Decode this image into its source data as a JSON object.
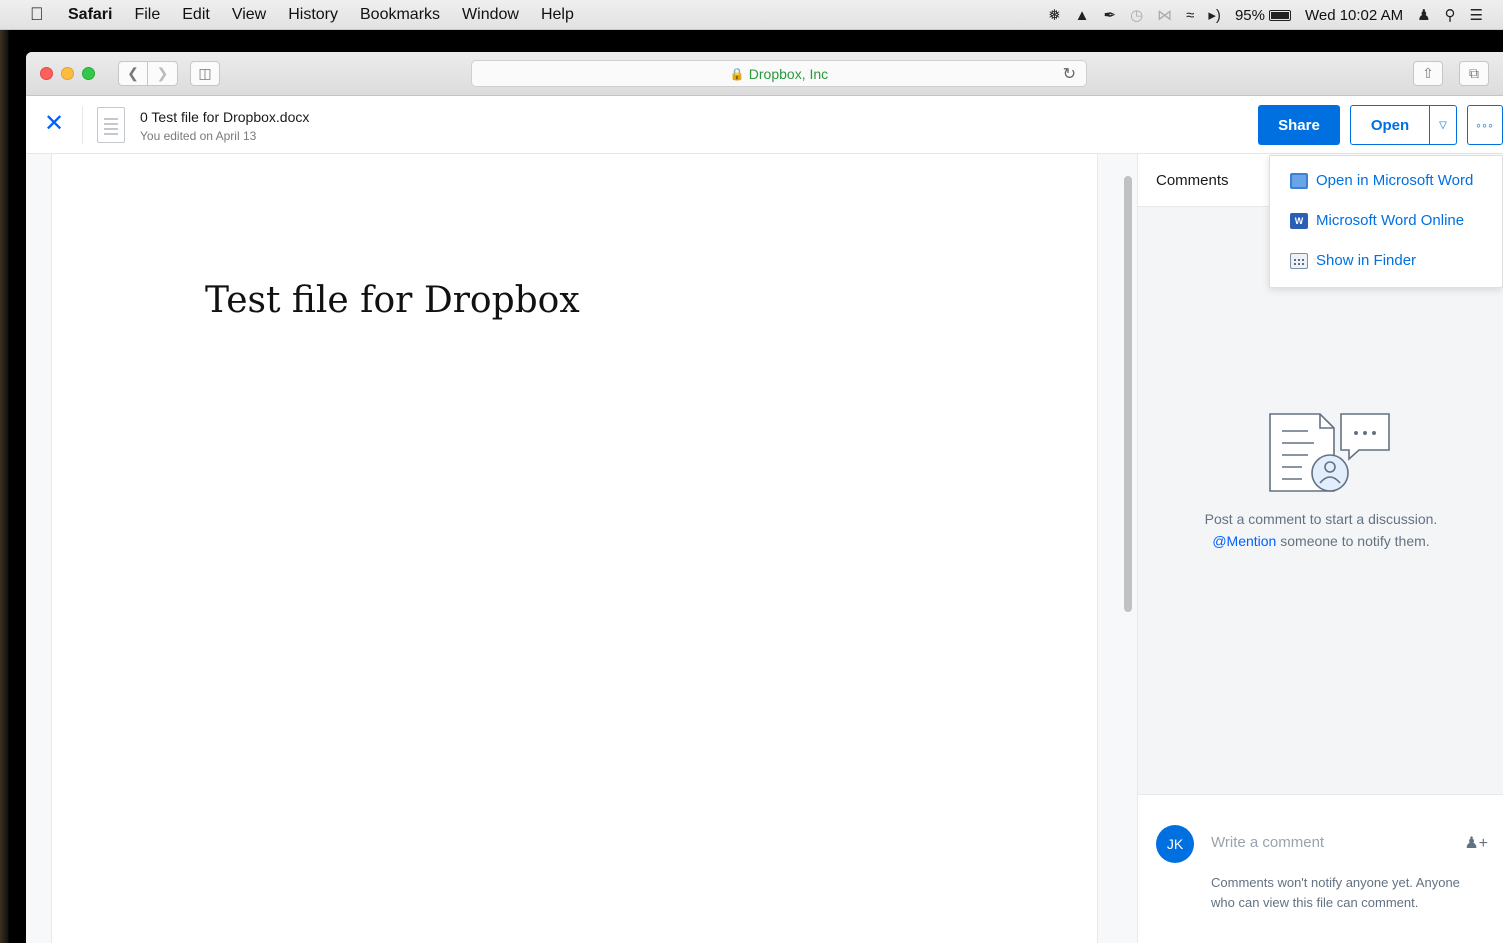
{
  "menubar": {
    "app_name": "Safari",
    "items": [
      "File",
      "Edit",
      "View",
      "History",
      "Bookmarks",
      "Window",
      "Help"
    ],
    "battery": "95%",
    "clock": "Wed 10:02 AM"
  },
  "browser": {
    "address": "Dropbox, Inc"
  },
  "file": {
    "name": "0 Test file for Dropbox.docx",
    "edited": "You edited on April 13"
  },
  "actions": {
    "share": "Share",
    "open": "Open",
    "more": "◦◦◦"
  },
  "open_menu": {
    "items": [
      "Open in Microsoft Word",
      "Microsoft Word Online",
      "Show in Finder"
    ]
  },
  "document": {
    "heading": "Test file for Dropbox"
  },
  "comments": {
    "title": "Comments",
    "empty_line1": "Post a comment to start a discussion.",
    "mention": "@Mention",
    "empty_line2_rest": " someone to notify them.",
    "avatar_initials": "JK",
    "placeholder": "Write a comment",
    "notice": "Comments won't notify anyone yet. Anyone who can view this file can comment."
  },
  "colors": {
    "accent": "#0070e0",
    "secure_green": "#2a9a3c"
  }
}
